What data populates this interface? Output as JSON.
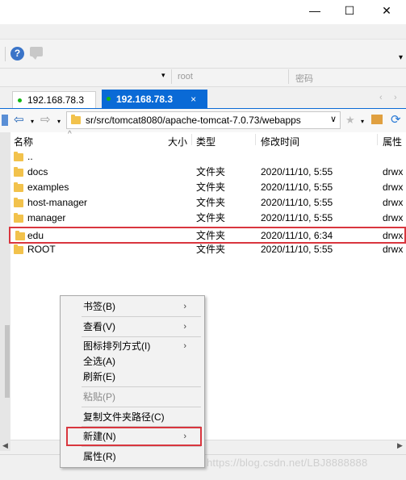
{
  "window": {
    "minimize_glyph": "—",
    "maximize_glyph": "☐",
    "close_glyph": "✕"
  },
  "toolbar": {
    "help_glyph": "?",
    "dropdown_glyph": "▾"
  },
  "address": {
    "user_placeholder": "root",
    "password_placeholder": "密码"
  },
  "tabs": [
    {
      "label": "192.168.78.3",
      "active": false
    },
    {
      "label": "192.168.78.3",
      "active": true,
      "close_glyph": "×"
    }
  ],
  "nav": {
    "path": "sr/src/tomcat8080/apache-tomcat-7.0.73/webapps",
    "path_dropdown": "∨"
  },
  "columns": {
    "name": "名称",
    "size": "大小",
    "type": "类型",
    "modified": "修改时间",
    "attributes": "属性",
    "sort_glyph": "^"
  },
  "files": [
    {
      "name": "..",
      "type": "",
      "modified": "",
      "attr": ""
    },
    {
      "name": "docs",
      "type": "文件夹",
      "modified": "2020/11/10, 5:55",
      "attr": "drwx"
    },
    {
      "name": "examples",
      "type": "文件夹",
      "modified": "2020/11/10, 5:55",
      "attr": "drwx"
    },
    {
      "name": "host-manager",
      "type": "文件夹",
      "modified": "2020/11/10, 5:55",
      "attr": "drwx"
    },
    {
      "name": "manager",
      "type": "文件夹",
      "modified": "2020/11/10, 5:55",
      "attr": "drwx"
    },
    {
      "name": "edu",
      "type": "文件夹",
      "modified": "2020/11/10, 6:34",
      "attr": "drwx",
      "highlighted": true
    },
    {
      "name": "ROOT",
      "type": "文件夹",
      "modified": "2020/11/10, 5:55",
      "attr": "drwx"
    }
  ],
  "context_menu": {
    "items": [
      {
        "label": "书签(B)",
        "submenu": true
      },
      {
        "label": "查看(V)",
        "submenu": true
      },
      {
        "label": "图标排列方式(I)",
        "submenu": true
      },
      {
        "label": "全选(A)",
        "submenu": false
      },
      {
        "label": "刷新(E)",
        "submenu": false
      },
      {
        "label": "粘贴(P)",
        "submenu": false,
        "disabled": true
      },
      {
        "label": "复制文件夹路径(C)",
        "submenu": false
      },
      {
        "label": "新建(N)",
        "submenu": true,
        "highlighted": true
      },
      {
        "label": "属性(R)",
        "submenu": false
      }
    ],
    "submenu_glyph": "›"
  },
  "watermark": "https://blog.csdn.net/LBJ8888888",
  "colors": {
    "accent": "#0a6ad6",
    "highlight_border": "#d9363e",
    "online_dot": "#14b814",
    "folder": "#f2c24c"
  }
}
